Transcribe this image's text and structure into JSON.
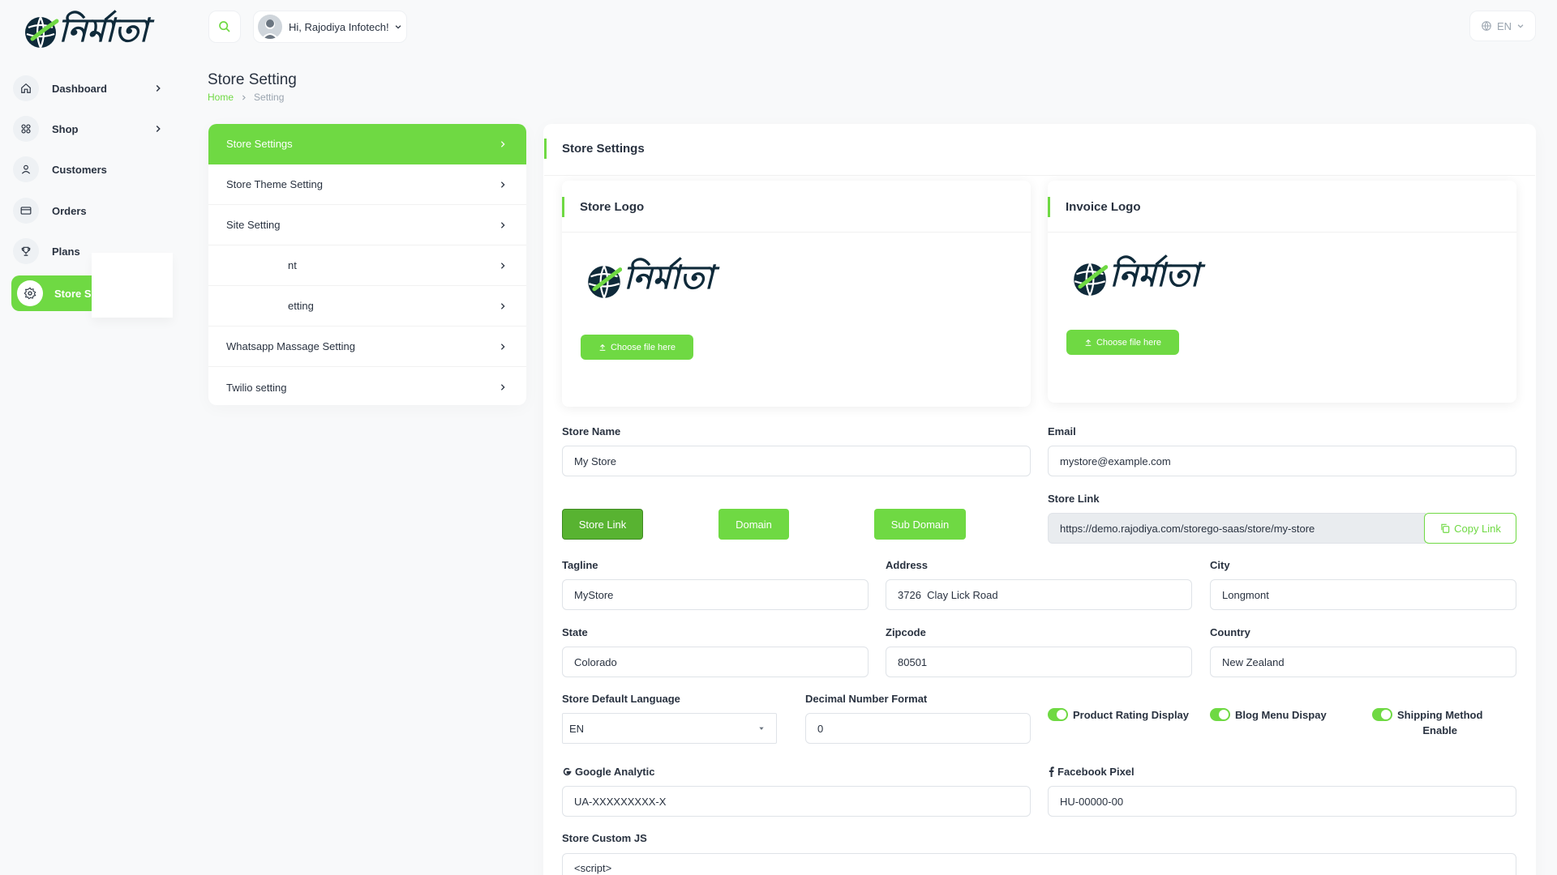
{
  "brand": {
    "logo_text": "নির্মাতা"
  },
  "sidebar": {
    "items": [
      {
        "label": "Dashboard",
        "icon": "home-icon"
      },
      {
        "label": "Shop",
        "icon": "grid-icon"
      },
      {
        "label": "Customers",
        "icon": "user-icon"
      },
      {
        "label": "Orders",
        "icon": "credit-card-icon"
      },
      {
        "label": "Plans",
        "icon": "trophy-icon"
      },
      {
        "label": "Store Setting",
        "icon": "settings-icon",
        "visible_label": "Store S"
      }
    ]
  },
  "header": {
    "greeting": "Hi, Rajodiya Infotech!",
    "language": "EN"
  },
  "page": {
    "title": "Store Setting",
    "breadcrumb": [
      "Home",
      "Setting"
    ]
  },
  "settings_menu": {
    "items": [
      {
        "label": "Store Settings",
        "active": true
      },
      {
        "label": "Store Theme Setting"
      },
      {
        "label": "Site Setting"
      },
      {
        "label": "nt",
        "partial": true
      },
      {
        "label": "etting",
        "partial": true
      },
      {
        "label": "Whatsapp Massage Setting"
      },
      {
        "label": "Twilio setting"
      }
    ]
  },
  "store_settings": {
    "title": "Store Settings",
    "store_logo": {
      "title": "Store Logo",
      "button": "Choose file here"
    },
    "invoice_logo": {
      "title": "Invoice Logo",
      "button": "Choose file here"
    },
    "store_name": {
      "label": "Store Name",
      "value": "My Store"
    },
    "email": {
      "label": "Email",
      "value": "mystore@example.com"
    },
    "link_buttons": [
      "Store Link",
      "Domain",
      "Sub Domain"
    ],
    "store_link": {
      "label": "Store Link",
      "value": "https://demo.rajodiya.com/storego-saas/store/my-store",
      "copy_label": "Copy Link"
    },
    "tagline": {
      "label": "Tagline",
      "value": "MyStore"
    },
    "address": {
      "label": "Address",
      "value": "3726  Clay Lick Road"
    },
    "city": {
      "label": "City",
      "value": "Longmont"
    },
    "state": {
      "label": "State",
      "value": "Colorado"
    },
    "zipcode": {
      "label": "Zipcode",
      "value": "80501"
    },
    "country": {
      "label": "Country",
      "value": "New Zealand"
    },
    "default_language": {
      "label": "Store Default Language",
      "value": "EN"
    },
    "decimal_format": {
      "label": "Decimal Number Format",
      "value": "0"
    },
    "toggles": [
      {
        "label": "Product Rating Display",
        "on": true
      },
      {
        "label": "Blog Menu Dispay",
        "on": true
      },
      {
        "label_line1": "Shipping Method",
        "label_line2": "Enable",
        "on": true
      }
    ],
    "google_analytic": {
      "label": "Google Analytic",
      "value": "UA-XXXXXXXXX-X"
    },
    "facebook_pixel": {
      "label": "Facebook Pixel",
      "value": "HU-00000-00"
    },
    "custom_js": {
      "label": "Store Custom JS",
      "value": "<script>"
    }
  },
  "colors": {
    "accent": "#6fd943",
    "text": "#293240",
    "muted": "#9aa4af"
  }
}
